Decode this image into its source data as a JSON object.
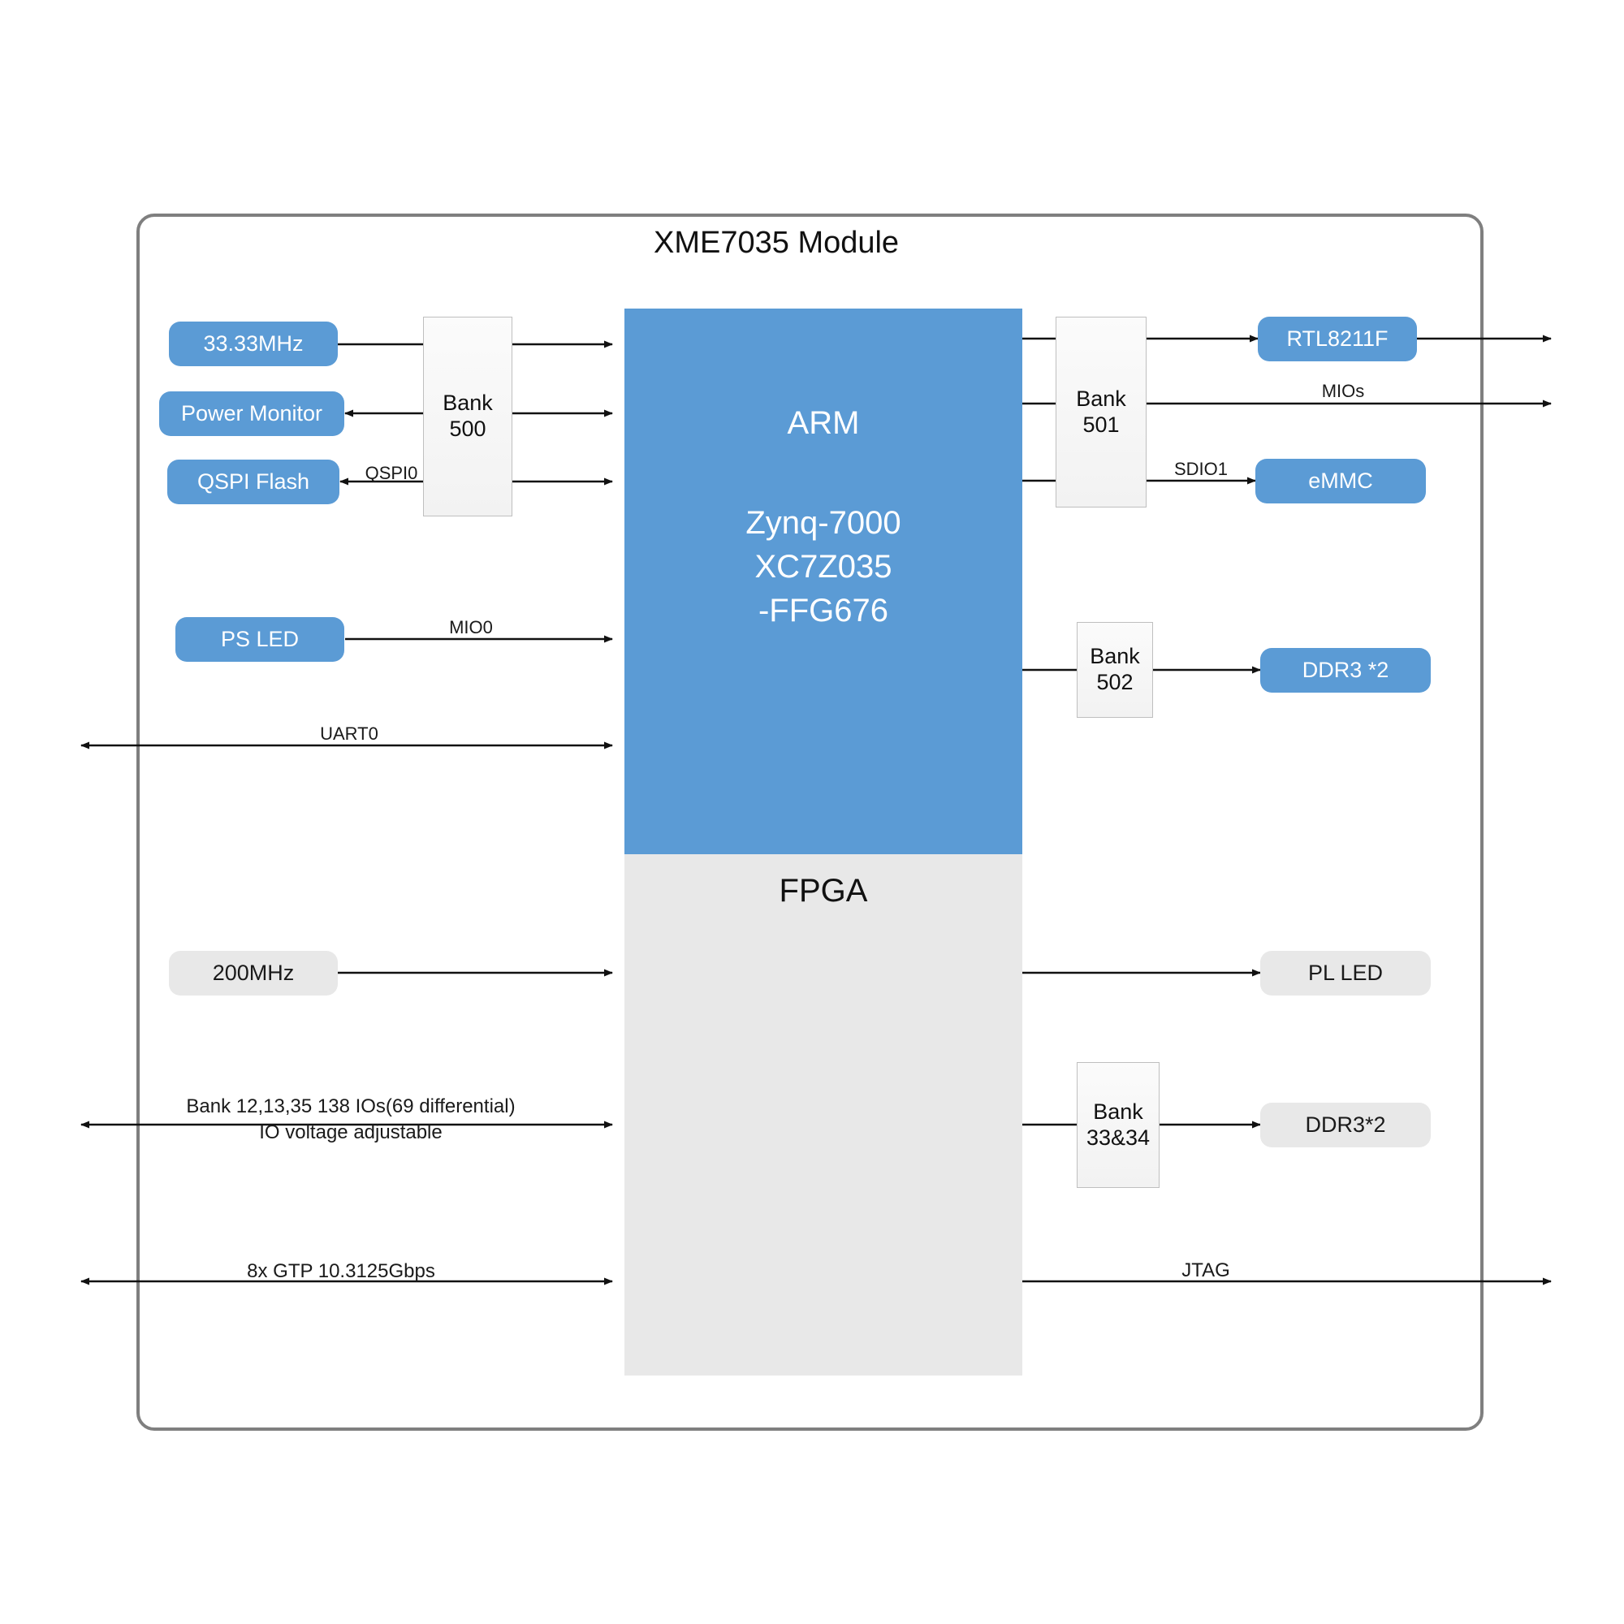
{
  "module": {
    "title": "XME7035 Module",
    "border_color": "#7F7F7F"
  },
  "soc": {
    "ps_label": "ARM",
    "part_line1": "Zynq-7000",
    "part_line2": "XC7Z035",
    "part_line3": "-FFG676",
    "pl_label": "FPGA",
    "ps_color": "#5B9BD5",
    "pl_color": "#E8E8E8"
  },
  "banks": [
    {
      "id": "bank-500",
      "line1": "Bank",
      "line2": "500"
    },
    {
      "id": "bank-501",
      "line1": "Bank",
      "line2": "501"
    },
    {
      "id": "bank-502",
      "line1": "Bank",
      "line2": "502"
    },
    {
      "id": "bank-33-34",
      "line1": "Bank",
      "line2": "33&34"
    }
  ],
  "peripherals": {
    "clock_33": {
      "label": "33.33MHz",
      "style": "blue"
    },
    "power_monitor": {
      "label": "Power Monitor",
      "style": "blue"
    },
    "qspi_flash": {
      "label": "QSPI Flash",
      "style": "blue"
    },
    "ps_led": {
      "label": "PS LED",
      "style": "blue"
    },
    "rtl8211f": {
      "label": "RTL8211F",
      "style": "blue"
    },
    "emmc": {
      "label": "eMMC",
      "style": "blue"
    },
    "ddr3_ps": {
      "label": "DDR3 *2",
      "style": "blue"
    },
    "clock_200": {
      "label": "200MHz",
      "style": "grey"
    },
    "pl_led": {
      "label": "PL LED",
      "style": "grey"
    },
    "ddr3_pl": {
      "label": "DDR3*2",
      "style": "grey"
    }
  },
  "wire_labels": {
    "qspi0": "QSPI0",
    "mios": "MIOs",
    "sdio1": "SDIO1",
    "mio0": "MIO0",
    "uart0": "UART0",
    "bank_io_line1": "Bank 12,13,35 138 IOs(69 differential)",
    "bank_io_line2": "IO voltage adjustable",
    "gtp": "8x GTP 10.3125Gbps",
    "jtag": "JTAG"
  }
}
